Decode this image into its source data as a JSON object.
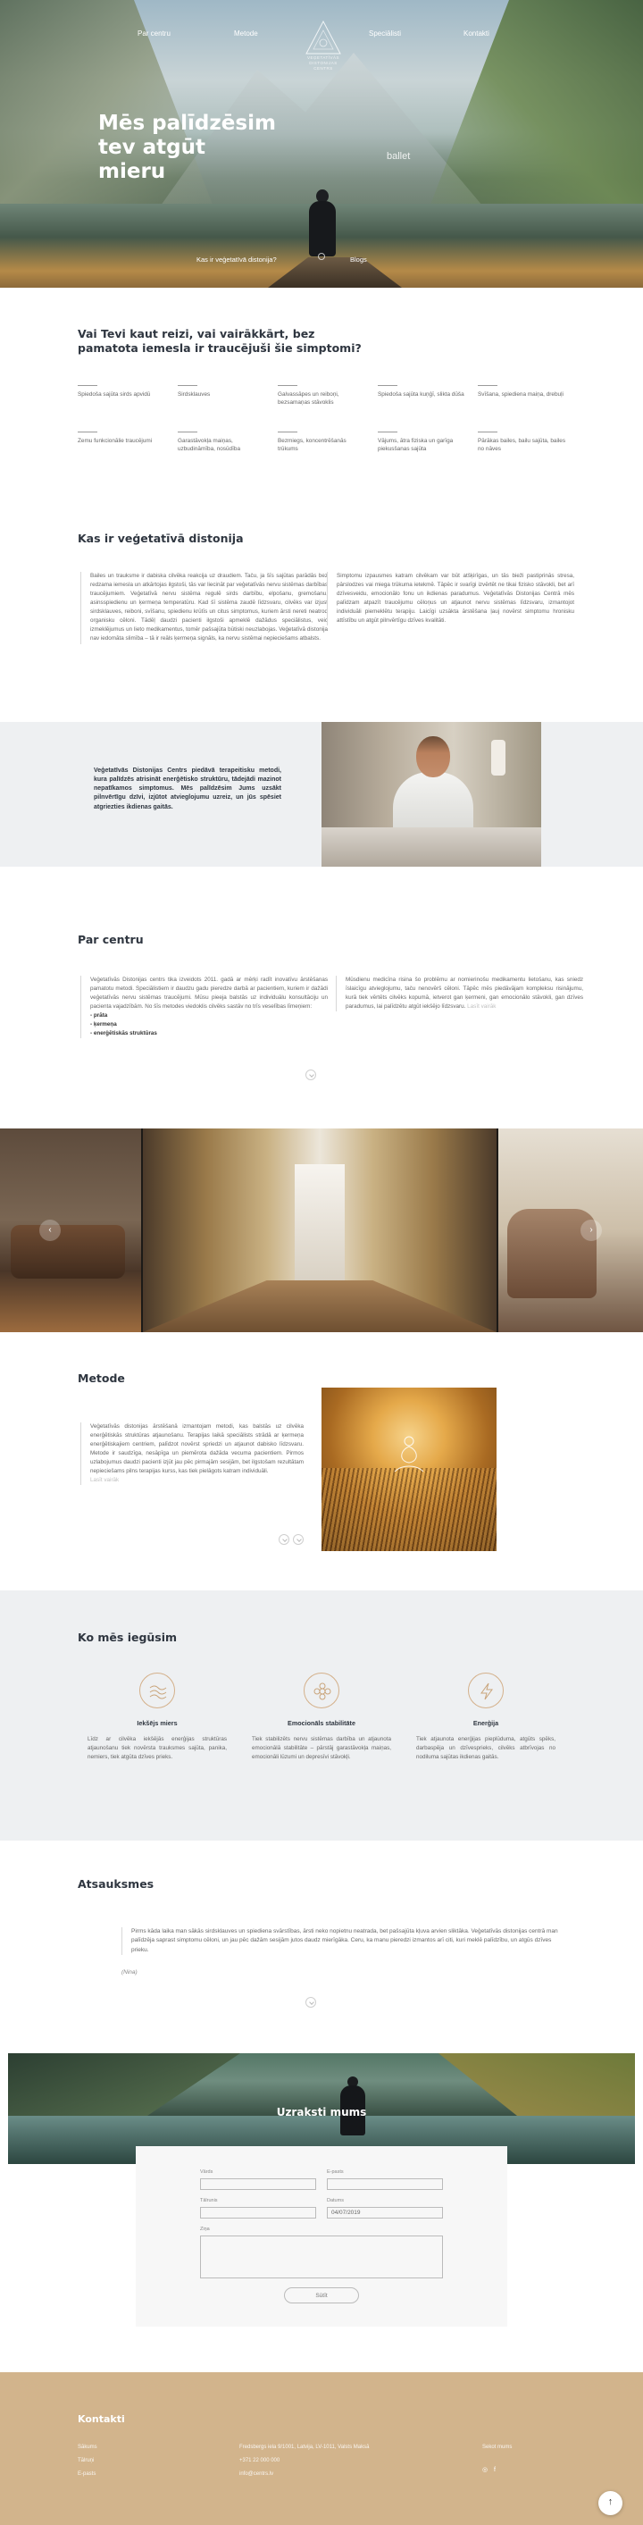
{
  "nav": {
    "about": "Par centru",
    "method": "Metode",
    "specialists": "Speciālisti",
    "contacts": "Kontakti"
  },
  "logo": {
    "line1": "VEĢETATĪVĀS",
    "line2": "DISTONIJAS",
    "line3": "CENTRS"
  },
  "hero": {
    "title": "Mēs palīdzēsim tev atgūt mieru",
    "side_text": "ballet",
    "link_left": "Kas ir veģetatīvā distonija?",
    "link_right": "Blogs"
  },
  "symptoms": {
    "title": "Vai Tevi kaut reizi, vai vairākkārt, bez pamatota iemesla ir traucējuši šie simptomi?",
    "items": [
      "Spiedoša sajūta sirds apvidū",
      "Sirdsklauves",
      "Galvassāpes un reiboņi, bezsamaņas stāvoklis",
      "Spiedoša sajūta kuņģī, slikta dūša",
      "Svīšana, spiediena maiņa, drebuļi",
      "Zemu funkcionālie traucējumi",
      "Garastāvokļa maiņas, uzbudināmība, nosūdība",
      "Bezmiegs, koncentrēšanās trūkums",
      "Vājums, ātra fiziska un garīga piekusšanas sajūta",
      "Pārākas bailes, bailu sajūta, bailes no nāves"
    ]
  },
  "distonia": {
    "title": "Kas ir veģetatīvā distonija",
    "left": "Bailes un trauksme ir dabiska cilvēka reakcija uz draudiem. Taču, ja šīs sajūtas parādās bez redzama iemesla un atkārtojas ilgstoši, tās var liecināt par veģetatīvās nervu sistēmas darbības traucējumiem. Veģetatīvā nervu sistēma regulē sirds darbību, elpošanu, gremošanu, asinsspiedienu un ķermeņa temperatūru. Kad šī sistēma zaudē līdzsvaru, cilvēks var izjust sirdsklauves, reiboni, svīšanu, spiedienu krūtīs un citus simptomus, kuriem ārsti nereti neatrod organisku cēloni. Tādēļ daudzi pacienti ilgstoši apmeklē dažādus speciālistus, veic izmeklējumus un lieto medikamentus, tomēr pašsajūta būtiski neuzlabojas. Veģetatīvā distonija nav iedomāta slimība – tā ir reāls ķermeņa signāls, ka nervu sistēmai nepieciešams atbalsts.",
    "right": "Simptomu izpausmes katram cilvēkam var būt atšķirīgas, un tās bieži pastiprinās stresa, pārslodzes vai miega trūkuma ietekmē. Tāpēc ir svarīgi izvērtēt ne tikai fizisko stāvokli, bet arī dzīvesveidu, emocionālo fonu un ikdienas paradumus. Veģetatīvās Distonijas Centrā mēs palīdzam atpazīt traucējumu cēloņus un atjaunot nervu sistēmas līdzsvaru, izmantojot individuāli piemeklētu terapiju. Laicīgi uzsākta ārstēšana ļauj novērst simptomu hronisku attīstību un atgūt pilnvērtīgu dzīves kvalitāti."
  },
  "card": {
    "text": "Veģetatīvās Distonijas Centrs piedāvā terapeitisku metodi, kura palīdzēs atrisināt enerģētisko struktūru, tādejādi mazinot nepatīkamos simptomus. Mēs palīdzēsim Jums uzsākt pilnvērtīgu dzīvi, izjūtot atvieglojumu uzreiz, un jūs spēsiet atgriezties ikdienas gaitās."
  },
  "about": {
    "title": "Par centru",
    "left": "Veģetatīvās Distonijas centrs tika izveidots 2011. gadā ar mērķi radīt inovatīvu ārstēšanas pamatotu metodi. Speciālistiem ir daudzu gadu pieredze darbā ar pacientiem, kuriem ir dažādi veģetatīvās nervu sistēmas traucējumi. Mūsu pieeja balstās uz individuālu konsultāciju un pacienta vajadzībām.",
    "list_intro": "No šīs metodes viedoklis cilvēks sastāv no trīs veselības līmeņiem:",
    "list": [
      "- prāta",
      "- ķermeņa",
      "- enerģētiskās struktūras"
    ],
    "right": "Mūsdienu medicīna risina šo problēmu ar nomierinošu medikamentu lietošanu, kas sniedz īslaicīgu atvieglojumu, taču nenovērš cēloni. Tāpēc mēs piedāvājam kompleksu risinājumu, kurā tiek vērtēts cilvēks kopumā, ietverot gan ķermeni, gan emocionālo stāvokli, gan dzīves paradumus, lai palīdzētu atgūt iekšējo līdzsvaru.",
    "more": "Lasīt vairāk"
  },
  "gallery": {
    "prev": "‹",
    "next": "›"
  },
  "method": {
    "title": "Metode",
    "text": "Veģetatīvās distonijas ārstēšanā izmantojam metodi, kas balstās uz cilvēka enerģētiskās struktūras atjaunošanu. Terapijas laikā speciālists strādā ar ķermeņa enerģētiskajiem centriem, palīdzot novērst spriedzi un atjaunot dabisko līdzsvaru. Metode ir saudzīga, nesāpīga un piemērota dažāda vecuma pacientiem. Pirmos uzlabojumus daudzi pacienti izjūt jau pēc pirmajām sesijām, bet ilgstošam rezultātam nepieciešams pilns terapijas kurss, kas tiek pielāgots katram individuāli.",
    "more": "Lasīt vairāk"
  },
  "benefits": {
    "title": "Ko mēs iegūsim",
    "items": [
      {
        "title": "Iekšējs miers",
        "text": "Līdz ar cilvēka iekšējās enerģijas struktūras atjaunošanu tiek novērsta trauksmes sajūta, panika, nemiers, tiek atgūta dzīves prieks."
      },
      {
        "title": "Emocionāls stabilitāte",
        "text": "Tiek stabilizēts nervu sistēmas darbība un atjaunota emocionālā stabilitāte – pārstāj garastāvokļa maiņas, emocionāli lūzumi un depresīvi stāvokļi."
      },
      {
        "title": "Enerģija",
        "text": "Tiek atjaunota enerģijas pieplūduma, atgūts spēks, darbaspēja un dzīvesprieks, cilvēks atbrīvojas no nodiluma sajūtas ikdienas gaitās."
      }
    ]
  },
  "reviews": {
    "title": "Atsauksmes",
    "quote": "Pirms kāda laika man sākās sirdsklauves un spiediena svārstības, ārsti neko nopietnu neatrada, bet pašsajūta kļuva arvien sliktāka. Veģetatīvās distonijas centrā man palīdzēja saprast simptomu cēloni, un jau pēc dažām sesijām jutos daudz mierīgāka. Ceru, ka manu pieredzi izmantos arī citi, kuri meklē palīdzību, un atgūs dzīves prieku.",
    "author": "(Nina)"
  },
  "form": {
    "banner_title": "Uzraksti mums",
    "name_label": "Vārds",
    "email_label": "E-pasts",
    "phone_label": "Tālrunis",
    "date_label": "Datums",
    "date_value": "04/07/2019",
    "message_label": "Ziņa",
    "submit": "Sūtīt"
  },
  "footer": {
    "title": "Kontakti",
    "links": [
      "Sākums",
      "Tālruņi",
      "E-pasts"
    ],
    "address": "Fredsbergs iela 9/1001, Latvija, LV-1011, Valsts Maksā",
    "phone": "+371 22 000 000",
    "email": "info@centrs.lv",
    "social_label": "Sekot mums",
    "instagram": "◎",
    "facebook": "f"
  },
  "to_top": "↑"
}
